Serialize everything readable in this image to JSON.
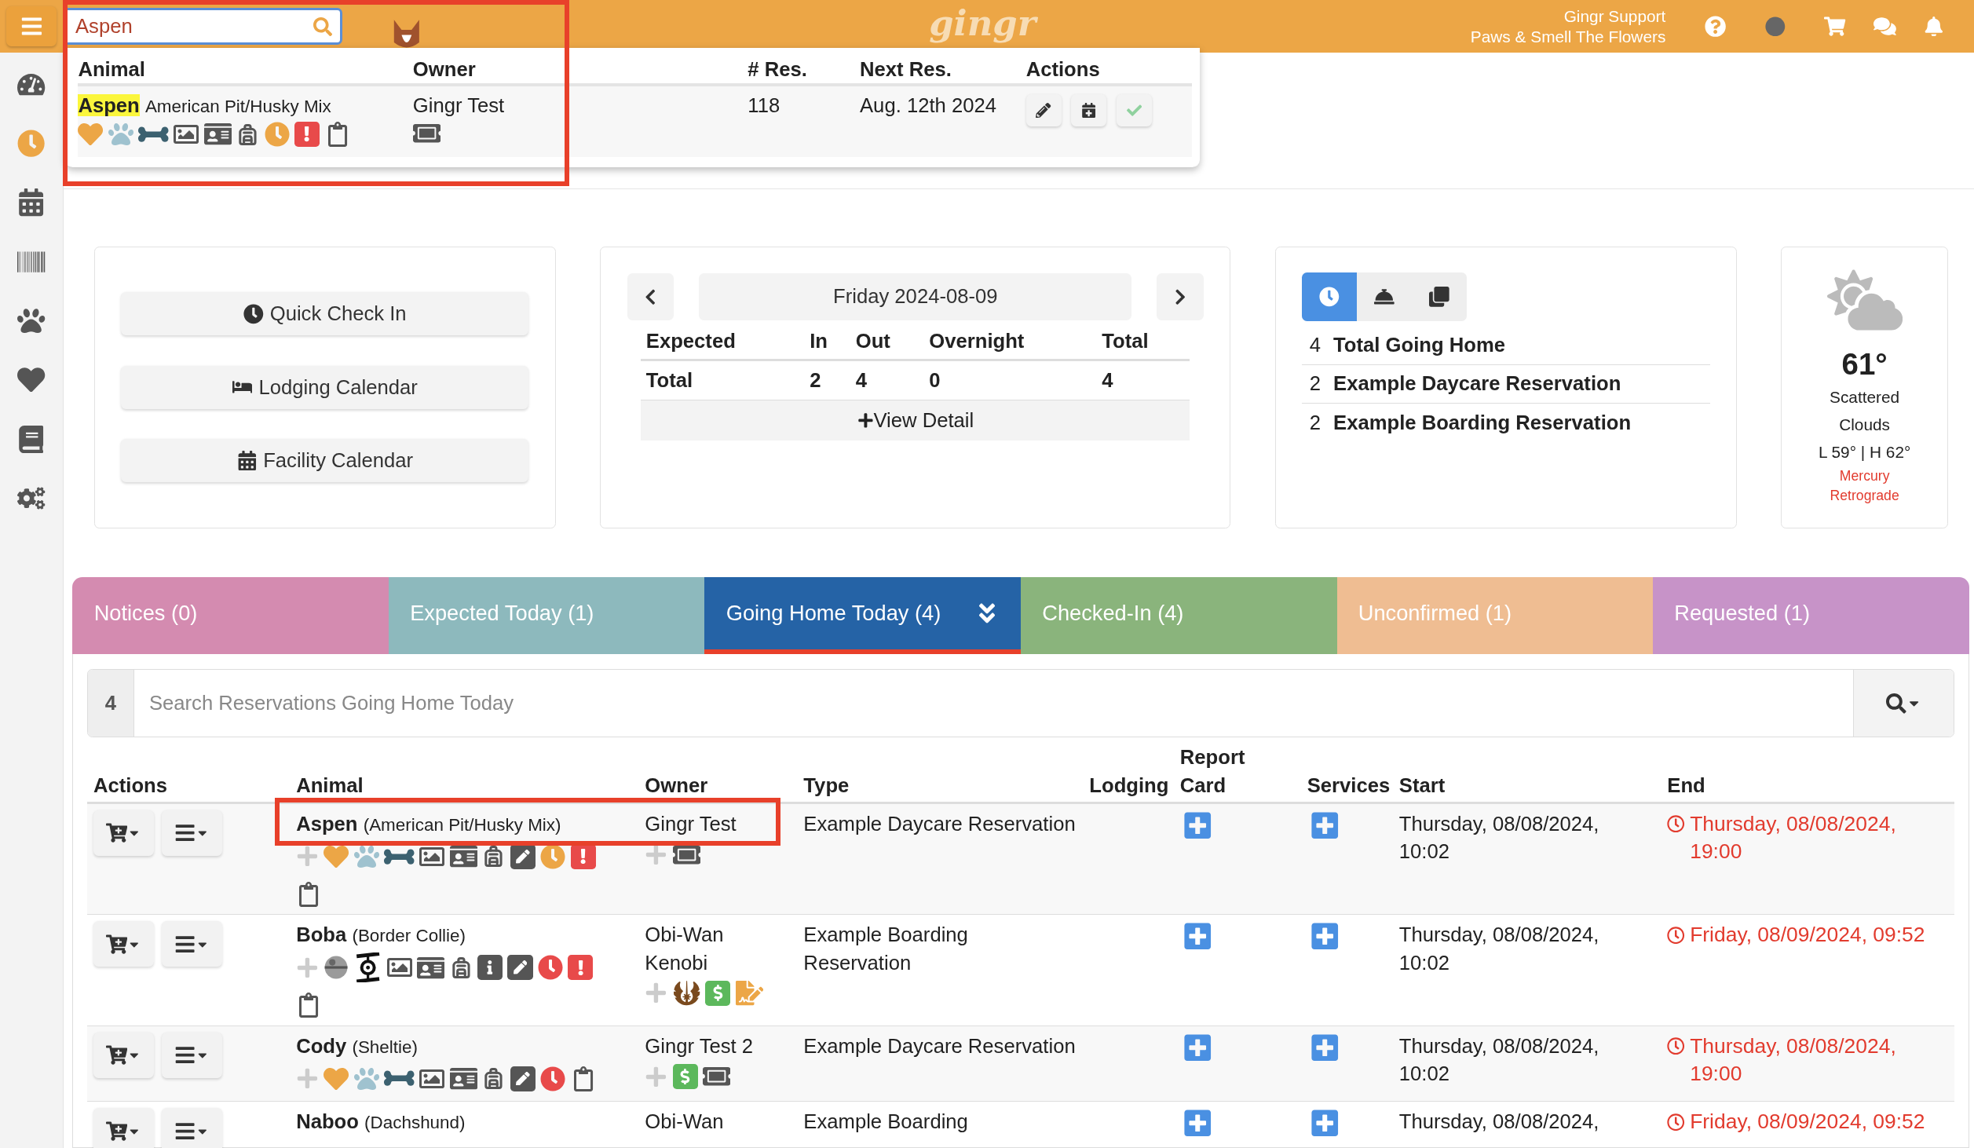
{
  "top_bar": {
    "search": {
      "value": "Aspen"
    },
    "logo": "gingr",
    "user": {
      "name": "Gingr Support",
      "location": "Paws & Smell The Flowers"
    }
  },
  "sidebar": {
    "items": [
      {
        "selected": false
      },
      {
        "selected": true
      },
      {
        "selected": false
      },
      {
        "selected": false
      },
      {
        "selected": false
      },
      {
        "selected": false
      },
      {
        "selected": false
      },
      {
        "selected": false
      }
    ]
  },
  "search_results": {
    "columns": [
      "Animal",
      "Owner",
      "# Res.",
      "Next Res.",
      "Actions"
    ],
    "rows": [
      {
        "name": "Aspen",
        "breed": "American Pit/Husky Mix",
        "owner": "Gingr Test",
        "res_count": "118",
        "next_res": "Aug. 12th 2024"
      }
    ]
  },
  "quick_links": [
    "Quick Check In",
    "Lodging Calendar",
    "Facility Calendar"
  ],
  "daily_summary": {
    "date": "Friday 2024-08-09",
    "columns": [
      "Expected",
      "In",
      "Out",
      "Overnight",
      "Total"
    ],
    "rows": [
      [
        "Total",
        "2",
        "4",
        "0",
        "4"
      ]
    ],
    "detail_link": "View Detail"
  },
  "going_home": {
    "views": [
      {
        "selected": true
      },
      {
        "selected": false
      },
      {
        "selected": false
      }
    ],
    "rows": [
      {
        "count": "4",
        "label": "Total Going Home"
      },
      {
        "count": "2",
        "label": "Example Daycare Reservation"
      },
      {
        "count": "2",
        "label": "Example Boarding Reservation"
      }
    ]
  },
  "weather": {
    "temperature": "61°",
    "condition": "Scattered Clouds",
    "range": "L 59° | H 62°",
    "note": "Mercury Retrograde"
  },
  "tabs": [
    {
      "label": "Notices (0)",
      "selected": false,
      "color": "#d48bb0"
    },
    {
      "label": "Expected Today (1)",
      "selected": false,
      "color": "#8db9bd"
    },
    {
      "label": "Going Home Today (4)",
      "selected": true,
      "color": "#2563a6"
    },
    {
      "label": "Checked-In (4)",
      "selected": false,
      "color": "#8ab47c"
    },
    {
      "label": "Unconfirmed (1)",
      "selected": false,
      "color": "#efbd92"
    },
    {
      "label": "Requested (1)",
      "selected": false,
      "color": "#c793c8"
    }
  ],
  "reservations": {
    "count": "4",
    "placeholder": "Search Reservations Going Home Today",
    "columns": [
      "Actions",
      "Animal",
      "Owner",
      "Type",
      "Lodging",
      "Report Card",
      "Services",
      "Start",
      "End"
    ],
    "rows": [
      {
        "animal": "Aspen",
        "breed": "(American Pit/Husky Mix)",
        "owner": "Gingr Test",
        "type": "Example Daycare Reservation",
        "start": "Thursday, 08/08/2024, 10:02",
        "end": "Thursday, 08/08/2024, 19:00"
      },
      {
        "animal": "Boba",
        "breed": "(Border Collie)",
        "owner": "Obi-Wan Kenobi",
        "type": "Example Boarding Reservation",
        "start": "Thursday, 08/08/2024, 10:02",
        "end": "Friday, 08/09/2024, 09:52"
      },
      {
        "animal": "Cody",
        "breed": "(Sheltie)",
        "owner": "Gingr Test 2",
        "type": "Example Daycare Reservation",
        "start": "Thursday, 08/08/2024, 10:02",
        "end": "Thursday, 08/08/2024, 19:00"
      },
      {
        "animal": "Naboo",
        "breed": "(Dachshund)",
        "owner": "Obi-Wan",
        "type": "Example Boarding",
        "start": "Thursday, 08/08/2024,",
        "end": "Friday, 08/09/2024, 09:52"
      }
    ]
  }
}
